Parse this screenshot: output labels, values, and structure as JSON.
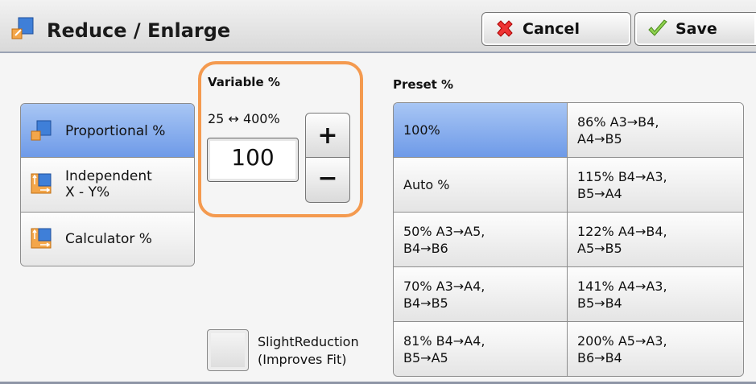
{
  "header": {
    "title": "Reduce / Enlarge",
    "cancel_label": "Cancel",
    "save_label": "Save"
  },
  "modes": [
    {
      "label": "Proportional %",
      "selected": true,
      "icon": "proportional-icon"
    },
    {
      "label": "Independent\nX - Y%",
      "selected": false,
      "icon": "independent-xy-icon"
    },
    {
      "label": "Calculator %",
      "selected": false,
      "icon": "calculator-icon"
    }
  ],
  "variable": {
    "title": "Variable %",
    "range": "25 ↔ 400%",
    "value": "100",
    "plus_label": "+",
    "minus_label": "−"
  },
  "slight_reduction": {
    "label": "SlightReduction\n(Improves Fit)",
    "checked": false
  },
  "preset": {
    "title": "Preset %",
    "cells": [
      "100%",
      "86% A3→B4,\nA4→B5",
      "Auto %",
      "115% B4→A3,\nB5→A4",
      "50% A3→A5,\nB4→B6",
      "122% A4→B4,\nA5→B5",
      "70% A3→A4,\nB4→B5",
      "141% A4→A3,\nB5→B4",
      "81% B4→A4,\nB5→A5",
      "200% A5→A3,\nB6→B4"
    ],
    "selected_index": 0
  },
  "colors": {
    "selected_blue": "#7fa6ec",
    "highlight_orange": "#f49a4f"
  }
}
